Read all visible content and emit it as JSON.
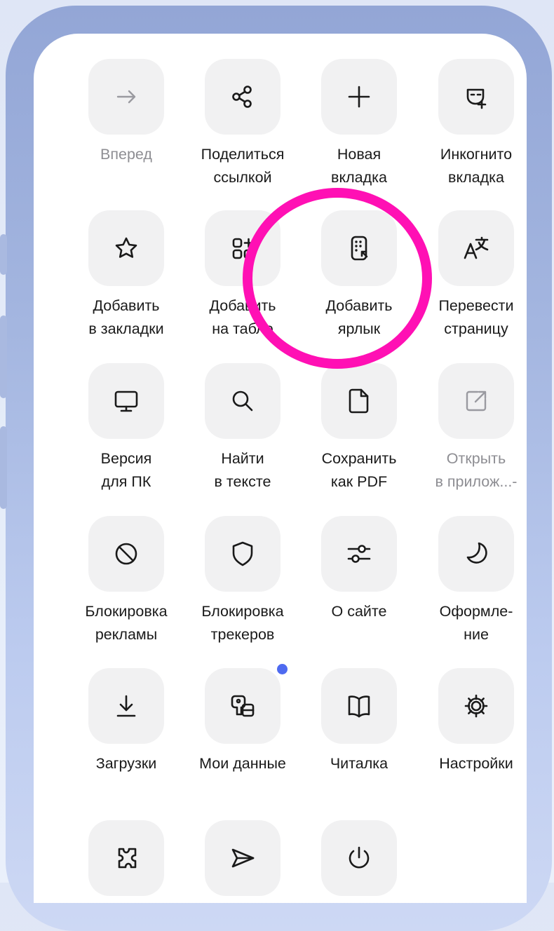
{
  "menu": {
    "items": [
      {
        "id": "forward",
        "label": "Вперед",
        "icon": "arrow-right-icon",
        "disabled": true
      },
      {
        "id": "share",
        "label": "Поделиться\nссылкой",
        "icon": "share-icon"
      },
      {
        "id": "new-tab",
        "label": "Новая\nвкладка",
        "icon": "plus-icon"
      },
      {
        "id": "incognito",
        "label": "Инкогнито\nвкладка",
        "icon": "incognito-mask-icon"
      },
      {
        "id": "bookmark",
        "label": "Добавить\nв закладки",
        "icon": "star-icon"
      },
      {
        "id": "tableau",
        "label": "Добавить\nна табло",
        "icon": "add-widget-icon"
      },
      {
        "id": "shortcut",
        "label": "Добавить\nярлык",
        "icon": "add-shortcut-icon",
        "highlighted": true
      },
      {
        "id": "translate",
        "label": "Перевести\nстраницу",
        "icon": "translate-icon"
      },
      {
        "id": "desktop",
        "label": "Версия\nдля ПК",
        "icon": "monitor-icon"
      },
      {
        "id": "find",
        "label": "Найти\nв тексте",
        "icon": "search-icon"
      },
      {
        "id": "pdf",
        "label": "Сохранить\nкак PDF",
        "icon": "document-icon"
      },
      {
        "id": "open-app",
        "label": "Открыть\nв прилож...-",
        "icon": "open-external-icon",
        "disabled": true
      },
      {
        "id": "adblock",
        "label": "Блокировка\nрекламы",
        "icon": "block-icon"
      },
      {
        "id": "trackers",
        "label": "Блокировка\nтрекеров",
        "icon": "shield-icon"
      },
      {
        "id": "site-info",
        "label": "О сайте",
        "icon": "sliders-icon"
      },
      {
        "id": "theme",
        "label": "Оформле-\nние",
        "icon": "moon-icon"
      },
      {
        "id": "downloads",
        "label": "Загрузки",
        "icon": "download-icon"
      },
      {
        "id": "my-data",
        "label": "Мои данные",
        "icon": "key-card-icon",
        "badge": true
      },
      {
        "id": "reader",
        "label": "Читалка",
        "icon": "book-icon"
      },
      {
        "id": "settings",
        "label": "Настройки",
        "icon": "gear-icon"
      },
      {
        "id": "extensions",
        "label": "",
        "icon": "puzzle-icon"
      },
      {
        "id": "send",
        "label": "",
        "icon": "paper-plane-icon"
      },
      {
        "id": "exit",
        "label": "",
        "icon": "power-icon"
      }
    ]
  },
  "colors": {
    "highlight": "#ff10b4",
    "badge": "#4e6af0",
    "tile_bg": "#f1f1f2",
    "label": "#1a1a1a",
    "disabled_label": "#8e8e93"
  }
}
